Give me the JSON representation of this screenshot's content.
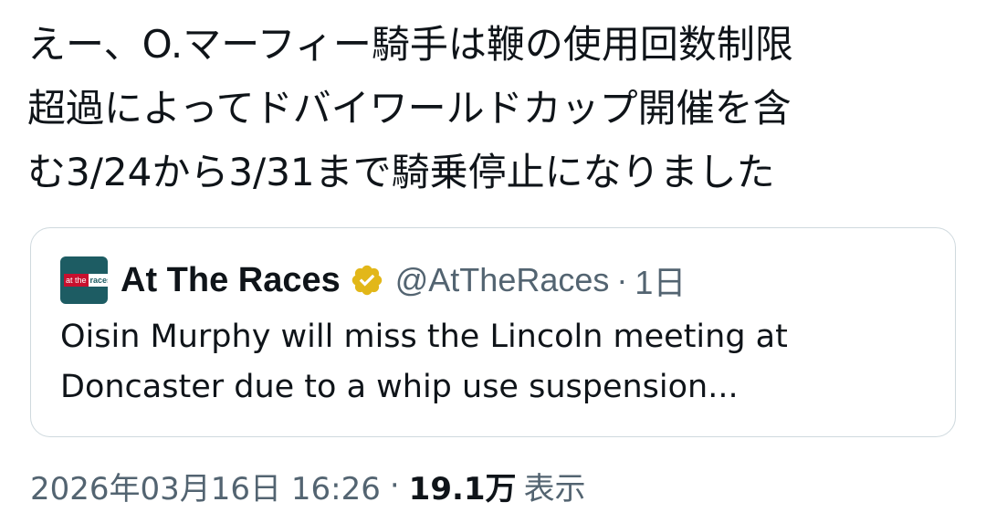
{
  "tweet": {
    "text_lines": [
      "えー、O.マーフィー騎手は鞭の使用回数制限",
      "超過によってドバイワールドカップ開催を含",
      "む3/24から3/31まで騎乗停止になりました"
    ]
  },
  "quote": {
    "avatar_logo": {
      "part1": "at the",
      "part2": "races"
    },
    "display_name": "At The Races",
    "verified_icon": "verified-badge-gold",
    "handle": "@AtTheRaces",
    "separator": "·",
    "time": "1日",
    "text_lines": [
      "Oisin Murphy will miss the Lincoln meeting at",
      "Doncaster due to a whip use suspension..."
    ]
  },
  "meta": {
    "timestamp": "2026年03月16日 16:26",
    "separator": "·",
    "views_count": "19.1万",
    "views_label": "表示"
  },
  "colors": {
    "text_primary": "#0f1419",
    "text_secondary": "#536471",
    "border": "#cfd9de",
    "verified_gold": "#e2b719",
    "avatar_bg": "#1d5c63"
  }
}
